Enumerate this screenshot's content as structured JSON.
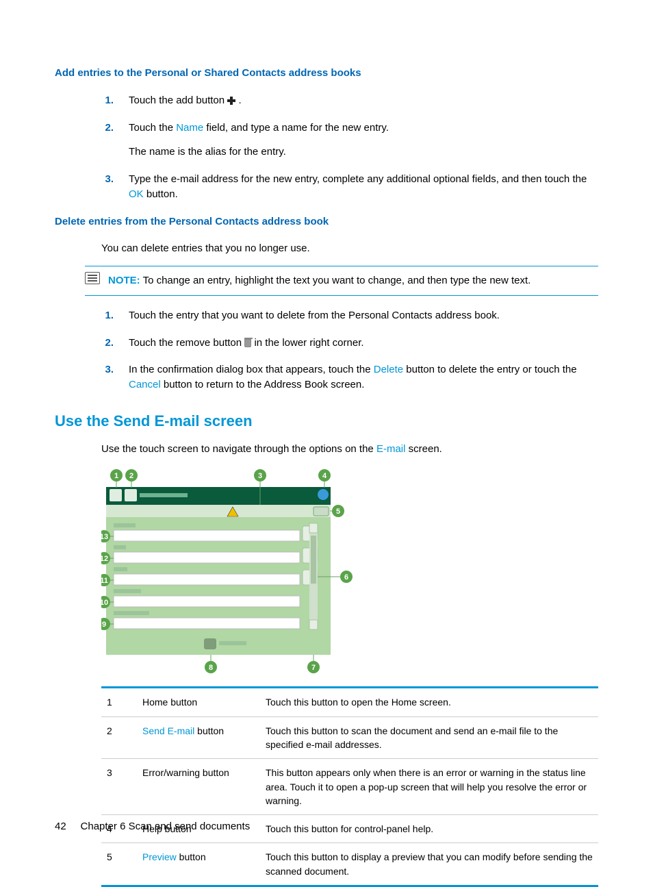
{
  "sections": {
    "add_heading": "Add entries to the Personal or Shared Contacts address books",
    "delete_heading": "Delete entries from the Personal Contacts address book",
    "use_heading": "Use the Send E-mail screen"
  },
  "add_steps": {
    "s1": {
      "num": "1.",
      "text_a": "Touch the add button ",
      "text_b": "."
    },
    "s2": {
      "num": "2.",
      "text_a": "Touch the ",
      "link": "Name",
      "text_b": " field, and type a name for the new entry.",
      "sub": "The name is the alias for the entry."
    },
    "s3": {
      "num": "3.",
      "text_a": "Type the e-mail address for the new entry, complete any additional optional fields, and then touch the ",
      "link": "OK",
      "text_b": " button."
    }
  },
  "delete_intro": "You can delete entries that you no longer use.",
  "note": {
    "label": "NOTE:",
    "text": "To change an entry, highlight the text you want to change, and then type the new text."
  },
  "delete_steps": {
    "s1": {
      "num": "1.",
      "text": "Touch the entry that you want to delete from the Personal Contacts address book."
    },
    "s2": {
      "num": "2.",
      "text_a": "Touch the remove button ",
      "text_b": " in the lower right corner."
    },
    "s3": {
      "num": "3.",
      "text_a": "In the confirmation dialog box that appears, touch the ",
      "link1": "Delete",
      "text_b": " button to delete the entry or touch the ",
      "link2": "Cancel",
      "text_c": " button to return to the Address Book screen."
    }
  },
  "use_intro": {
    "a": "Use the touch screen to navigate through the options on the ",
    "link": "E-mail",
    "b": " screen."
  },
  "callouts": [
    "1",
    "2",
    "3",
    "4",
    "5",
    "6",
    "7",
    "8",
    "9",
    "10",
    "11",
    "12",
    "13"
  ],
  "table": [
    {
      "n": "1",
      "name_a": "Home button",
      "desc": "Touch this button to open the Home screen."
    },
    {
      "n": "2",
      "name_link": "Send E-mail",
      "name_b": " button",
      "desc": "Touch this button to scan the document and send an e-mail file to the specified e-mail addresses."
    },
    {
      "n": "3",
      "name_a": "Error/warning button",
      "desc": "This button appears only when there is an error or warning in the status line area. Touch it to open a pop-up screen that will help you resolve the error or warning."
    },
    {
      "n": "4",
      "name_a": "Help button",
      "desc": "Touch this button for control-panel help."
    },
    {
      "n": "5",
      "name_link": "Preview",
      "name_b": " button",
      "desc": "Touch this button to display a preview that you can modify before sending the scanned document."
    }
  ],
  "footer": {
    "page": "42",
    "text": "Chapter 6   Scan and send documents"
  }
}
